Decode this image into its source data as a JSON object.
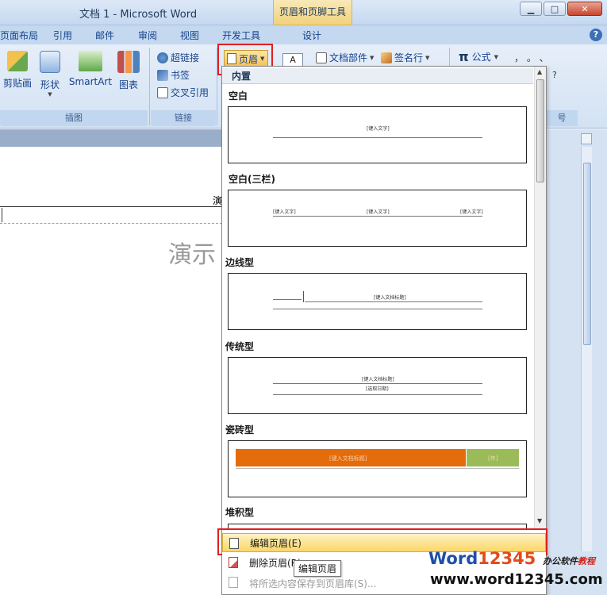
{
  "window": {
    "title": "文档 1 - Microsoft Word",
    "context_tab": "页眉和页脚工具",
    "minimize": "▁",
    "maximize": "□",
    "close": "✕"
  },
  "ribbon_tabs": [
    "页面布局",
    "引用",
    "邮件",
    "审阅",
    "视图",
    "开发工具",
    "设计"
  ],
  "help_label": "?",
  "ribbon": {
    "illustrations_group": {
      "label": "插图",
      "buttons": [
        "剪贴画",
        "形状",
        "SmartArt",
        "图表"
      ]
    },
    "links_group": {
      "label": "链接",
      "buttons": [
        "超链接",
        "书签",
        "交叉引用"
      ]
    },
    "header_footer": {
      "header_button": "页眉",
      "text_box_icon": "A",
      "quick_parts": "文档部件",
      "signature_line": "签名行",
      "equation": "公式",
      "symbols": "，  。  、",
      "partial_group_label": "号",
      "right_q": "?"
    }
  },
  "document": {
    "header_text": "演",
    "body_text": "演示"
  },
  "gallery": {
    "section_builtin": "内置",
    "templates": [
      {
        "name": "空白",
        "placeholders": [
          "[键入文字]"
        ]
      },
      {
        "name": "空白(三栏)",
        "placeholders": [
          "[键入文字]",
          "[键入文字]",
          "[键入文字]"
        ]
      },
      {
        "name": "边线型",
        "placeholders": [
          "[键入文档标题]"
        ]
      },
      {
        "name": "传统型",
        "placeholders": [
          "[键入文档标题]",
          "[选取日期]"
        ]
      },
      {
        "name": "瓷砖型",
        "placeholders": [
          "[键入文档标题]",
          "[年]"
        ]
      },
      {
        "name": "堆积型",
        "placeholders": []
      }
    ],
    "scroll_up": "▲",
    "scroll_down": "▼"
  },
  "menu": {
    "edit_header": "编辑页眉(E)",
    "remove_header": "删除页眉(R)",
    "save_to_gallery": "将所选内容保存到页眉库(S)..."
  },
  "tooltip": "编辑页眉",
  "watermark": {
    "brand_w": "Word",
    "brand_num": "12345",
    "slogan_a": "办公软件",
    "slogan_b": "教程",
    "url": "www.word12345.com"
  }
}
